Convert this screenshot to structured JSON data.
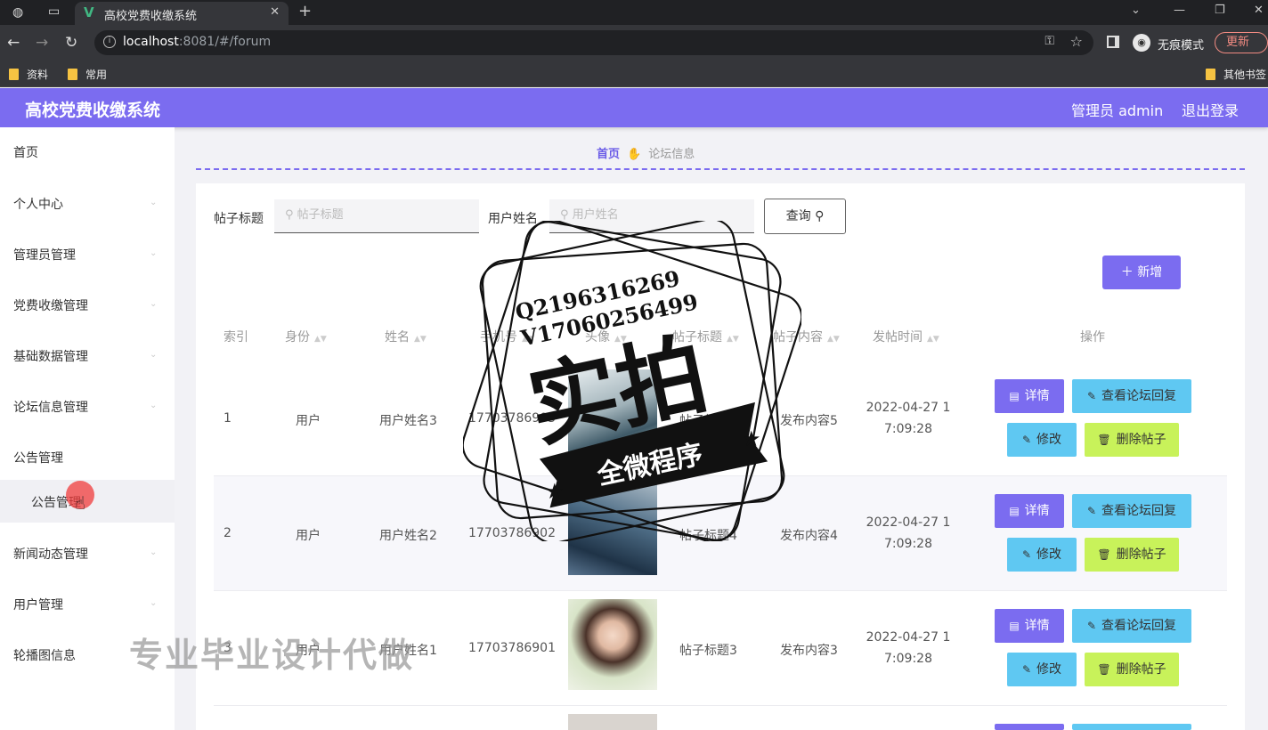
{
  "browser": {
    "tab_title": "高校党费收缴系统",
    "url_host": "localhost",
    "url_rest": ":8081/#/forum",
    "incognito_label": "无痕模式",
    "update_label": "更新",
    "bookmarks": [
      "资料",
      "常用"
    ],
    "other_bookmarks": "其他书签"
  },
  "app": {
    "title": "高校党费收缴系统",
    "user_label": "管理员 admin",
    "logout_label": "退出登录"
  },
  "sidebar": {
    "items": [
      "首页",
      "个人中心",
      "管理员管理",
      "党费收缴管理",
      "基础数据管理",
      "论坛信息管理",
      "公告管理",
      "新闻动态管理",
      "用户管理",
      "轮播图信息"
    ],
    "sub_item": "公告管理"
  },
  "breadcrumb": {
    "home": "首页",
    "current": "论坛信息"
  },
  "search": {
    "title_label": "帖子标题",
    "title_placeholder": "帖子标题",
    "user_label": "用户姓名",
    "user_placeholder": "用户姓名",
    "query_label": "查询"
  },
  "add_label": "新增",
  "table": {
    "headers": [
      "索引",
      "身份",
      "姓名",
      "手机号",
      "头像",
      "帖子标题",
      "帖子内容",
      "发帖时间",
      "操作"
    ],
    "rows": [
      {
        "index": "1",
        "role": "用户",
        "name": "用户姓名3",
        "phone": "17703786903",
        "title": "帖子标题5",
        "content": "发布内容5",
        "time1": "2022-04-27 1",
        "time2": "7:09:28"
      },
      {
        "index": "2",
        "role": "用户",
        "name": "用户姓名2",
        "phone": "17703786902",
        "title": "帖子标题4",
        "content": "发布内容4",
        "time1": "2022-04-27 1",
        "time2": "7:09:28"
      },
      {
        "index": "3",
        "role": "用户",
        "name": "用户姓名1",
        "phone": "17703786901",
        "title": "帖子标题3",
        "content": "发布内容3",
        "time1": "2022-04-27 1",
        "time2": "7:09:28"
      }
    ],
    "ops": {
      "detail": "详情",
      "reply": "查看论坛回复",
      "edit": "修改",
      "delete": "删除帖子"
    }
  },
  "watermark": {
    "line1": "Q2196316269",
    "line2": "V17060256499",
    "big": "实拍",
    "ribbon": "全微程序",
    "bottom": "专业毕业设计代做"
  }
}
